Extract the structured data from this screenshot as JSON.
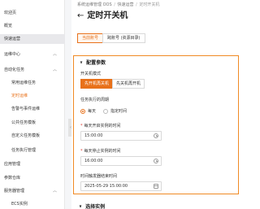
{
  "sidebar": {
    "items": [
      {
        "label": "欢迎页"
      },
      {
        "label": "概览"
      },
      {
        "label": "快速运营"
      },
      {
        "label": "运维中心"
      },
      {
        "label": "自动化任务"
      },
      {
        "label": "常用运维任务"
      },
      {
        "label": "定时运维"
      },
      {
        "label": "告警与事件运维"
      },
      {
        "label": "公共任务模板"
      },
      {
        "label": "自定义任务模板"
      },
      {
        "label": "任务执行管理"
      },
      {
        "label": "应用管理"
      },
      {
        "label": "参数仓库"
      },
      {
        "label": "服务器管理"
      },
      {
        "label": "ECS实例"
      }
    ]
  },
  "header": {
    "breadcrumb": [
      "系统运维管理 OOS",
      "快速运营",
      "定时开关机"
    ],
    "title": "定时开关机"
  },
  "tabs": [
    {
      "label": "当前账号"
    },
    {
      "label": "跨账号 (资源目录)"
    }
  ],
  "config": {
    "section_title": "配置参数",
    "mode_label": "开关机模式",
    "modes": [
      "先开机再关机",
      "先关机再开机"
    ],
    "cycle_label": "任务执行的周期",
    "cycle_options": [
      "每天",
      "指定时间"
    ],
    "start_label": "每天开启实例的时间",
    "start_value": "15:00:00",
    "stop_label": "每天停止实例的时间",
    "stop_value": "16:00:00",
    "end_label": "时间触发器结束时间",
    "end_value": "2025-05-29 15:00:00"
  },
  "section2_title": "选择实例",
  "colors": {
    "accent": "#e8711a",
    "panel_border": "#f08a24"
  }
}
